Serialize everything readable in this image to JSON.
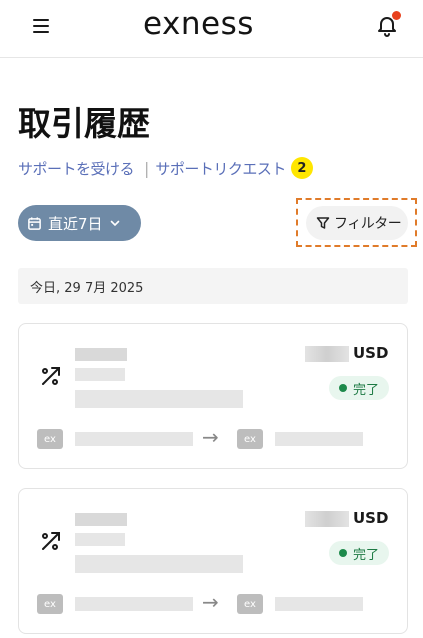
{
  "header": {
    "logo_text": "exness",
    "menu_icon": "hamburger-menu-icon",
    "notification_icon": "bell-icon",
    "notification_dot_color": "#e8421e"
  },
  "page": {
    "title": "取引履歴",
    "support_link": "サポートを受ける",
    "separator": "|",
    "support_request_link": "サポートリクエスト",
    "support_request_count": "2"
  },
  "filters": {
    "date_range_label": "直近7日",
    "date_range_icon": "calendar-icon",
    "filter_label": "フィルター",
    "filter_icon": "funnel-icon"
  },
  "list": {
    "date_header": "今日, 29 7月 2025",
    "transactions": [
      {
        "type_icon": "transfer-percent-icon",
        "currency": "USD",
        "status": "完了",
        "from_logo": "ex",
        "to_logo": "ex",
        "arrow": "→"
      },
      {
        "type_icon": "transfer-percent-icon",
        "currency": "USD",
        "status": "完了",
        "from_logo": "ex",
        "to_logo": "ex",
        "arrow": "→"
      }
    ]
  },
  "colors": {
    "accent_link": "#5a6fb8",
    "badge": "#ffe600",
    "date_pill": "#6f8aa6",
    "status_bg": "#e8f6ee",
    "status_text": "#1d7a44"
  }
}
